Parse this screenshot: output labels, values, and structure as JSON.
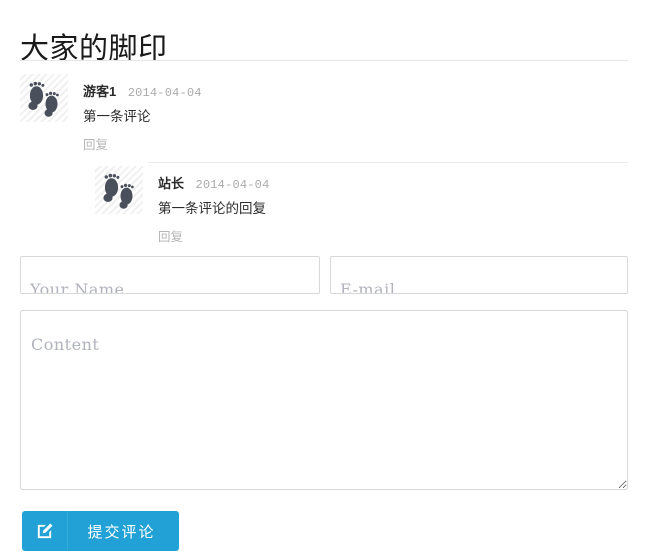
{
  "page": {
    "title": "大家的脚印"
  },
  "comments": [
    {
      "author": "游客1",
      "date": "2014-04-04",
      "text": "第一条评论",
      "reply_label": "回复",
      "avatar_icon": "footprints-icon"
    },
    {
      "author": "站长",
      "date": "2014-04-04",
      "text": "第一条评论的回复",
      "reply_label": "回复",
      "avatar_icon": "footprints-icon"
    }
  ],
  "form": {
    "name": {
      "placeholder": "Your Name",
      "value": ""
    },
    "email": {
      "placeholder": "E-mail",
      "value": ""
    },
    "content": {
      "placeholder": "Content",
      "value": ""
    },
    "submit": {
      "label": "提交评论",
      "icon": "edit-square-icon"
    }
  },
  "colors": {
    "accent": "#22a1d6",
    "accent_divider": "#35abdc",
    "text": "#2b2b2b",
    "muted": "#aaaaaa",
    "placeholder": "#b0b3bb",
    "border": "#d8d8d8",
    "rule": "#e6e6e6",
    "avatar_ink": "#4a4f5c"
  }
}
